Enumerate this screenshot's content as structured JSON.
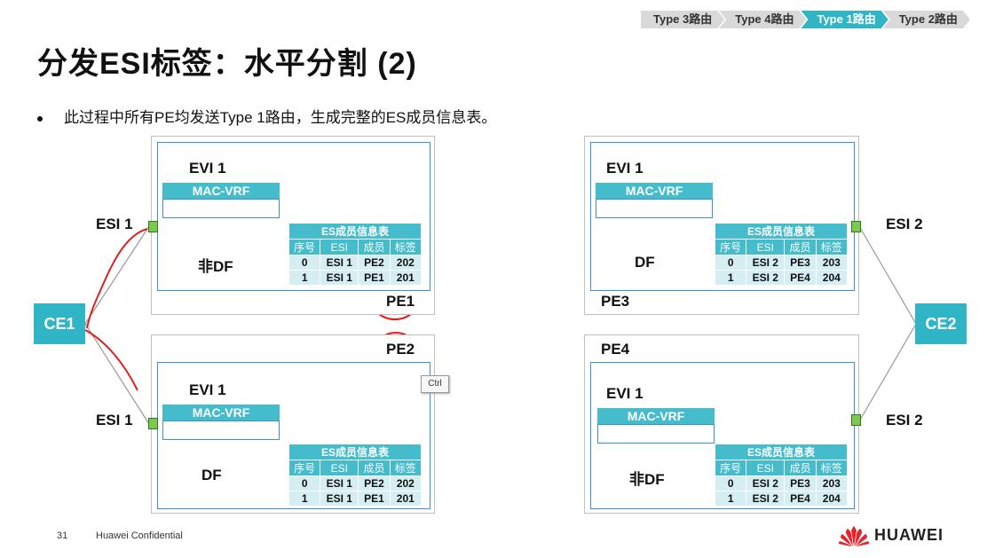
{
  "breadcrumbs": [
    {
      "label": "Type 3路由",
      "active": false
    },
    {
      "label": "Type 4路由",
      "active": false
    },
    {
      "label": "Type 1路由",
      "active": true
    },
    {
      "label": "Type 2路由",
      "active": false
    }
  ],
  "title": "分发ESI标签：水平分割 (2)",
  "bullet": "此过程中所有PE均发送Type 1路由，生成完整的ES成员信息表。",
  "table_headers": [
    "序号",
    "ESI",
    "成员",
    "标签"
  ],
  "table_title": "ES成员信息表",
  "vrf_label": "MAC-VRF",
  "pe1": {
    "name": "PE1",
    "evi": "EVI 1",
    "role": "非DF",
    "rows": [
      [
        "0",
        "ESI 1",
        "PE2",
        "202"
      ],
      [
        "1",
        "ESI 1",
        "PE1",
        "201"
      ]
    ]
  },
  "pe2": {
    "name": "PE2",
    "evi": "EVI 1",
    "role": "DF",
    "rows": [
      [
        "0",
        "ESI 1",
        "PE2",
        "202"
      ],
      [
        "1",
        "ESI 1",
        "PE1",
        "201"
      ]
    ]
  },
  "pe3": {
    "name": "PE3",
    "evi": "EVI 1",
    "role": "DF",
    "rows": [
      [
        "0",
        "ESI 2",
        "PE3",
        "203"
      ],
      [
        "1",
        "ESI 2",
        "PE4",
        "204"
      ]
    ]
  },
  "pe4": {
    "name": "PE4",
    "evi": "EVI 1",
    "role": "非DF",
    "rows": [
      [
        "0",
        "ESI 2",
        "PE3",
        "203"
      ],
      [
        "1",
        "ESI 2",
        "PE4",
        "204"
      ]
    ]
  },
  "esi_left_top": "ESI 1",
  "esi_left_bottom": "ESI 1",
  "esi_right_top": "ESI 2",
  "esi_right_bottom": "ESI 2",
  "ce1": "CE1",
  "ce2": "CE2",
  "ctrl_tooltip": "Ctrl",
  "footer": {
    "page": "31",
    "confidential": "Huawei Confidential",
    "brand": "HUAWEI"
  },
  "colors": {
    "accent": "#2fb5c6",
    "annotation": "#e02020",
    "port": "#7ec850"
  }
}
